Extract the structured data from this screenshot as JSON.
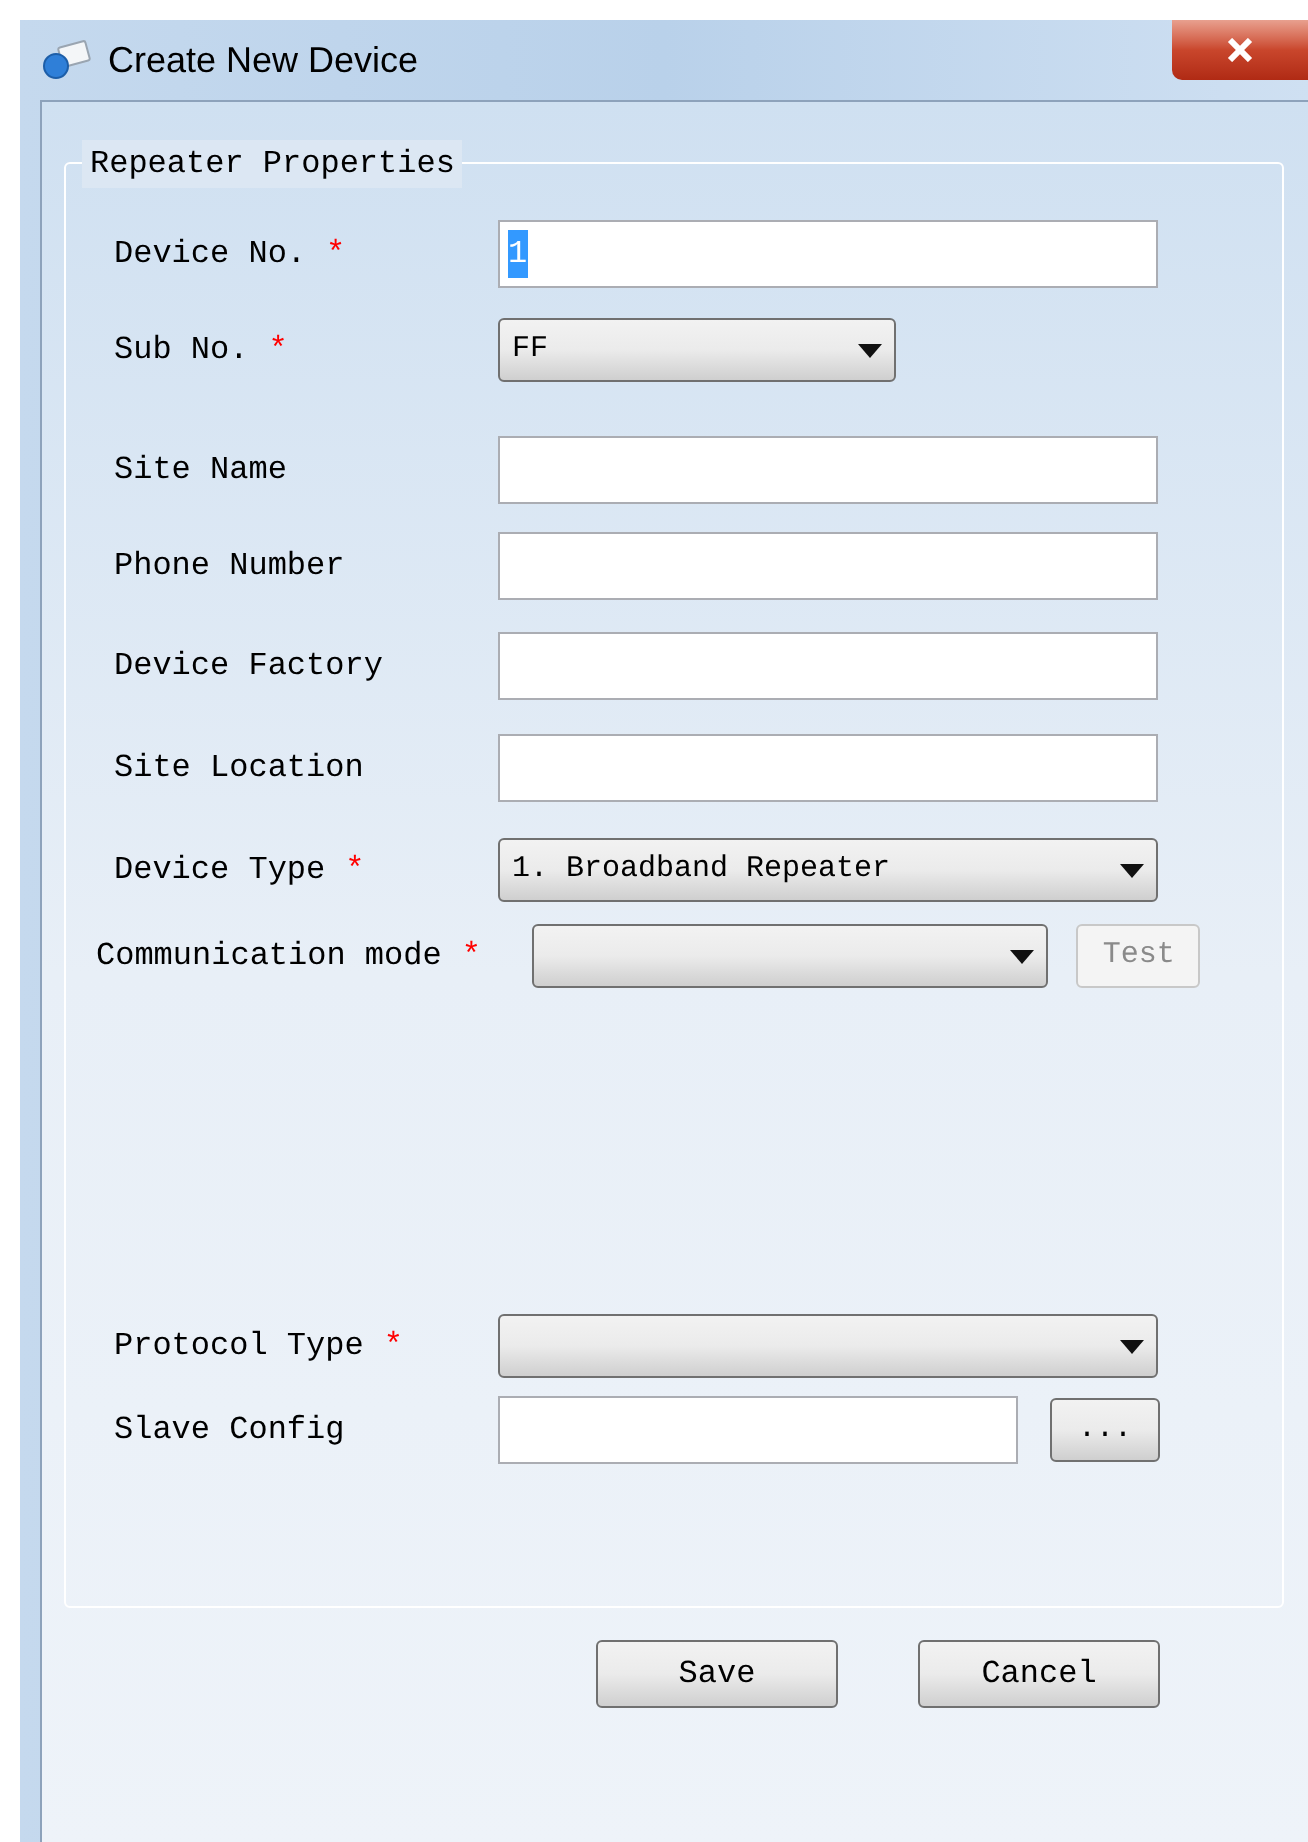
{
  "window": {
    "title": "Create New Device"
  },
  "group": {
    "title": "Repeater Properties"
  },
  "fields": [
    {
      "label": "Device No.",
      "required": true,
      "kind": "text",
      "value": "1",
      "selected": true
    },
    {
      "label": "Sub No.",
      "required": true,
      "kind": "short-select",
      "value": "FF"
    },
    {
      "label": "Site Name",
      "required": false,
      "kind": "text"
    },
    {
      "label": "Phone Number",
      "required": false,
      "kind": "text"
    },
    {
      "label": "Device Factory",
      "required": false,
      "kind": "text"
    },
    {
      "label": "Site Location",
      "required": false,
      "kind": "text"
    },
    {
      "label": "Device Type",
      "required": true,
      "kind": "select",
      "value": "1. Broadband Repeater"
    },
    {
      "label": "Communication mode",
      "required": true,
      "kind": "select-button",
      "button": {
        "label": "Test",
        "disabled": true
      }
    },
    {
      "label": "Protocol Type",
      "required": true,
      "kind": "select"
    },
    {
      "label": "Slave Config",
      "required": false,
      "kind": "text-button",
      "button": {
        "label": "...",
        "disabled": false
      }
    }
  ],
  "required_mark": "*",
  "buttons": [
    "Save",
    "Cancel"
  ]
}
